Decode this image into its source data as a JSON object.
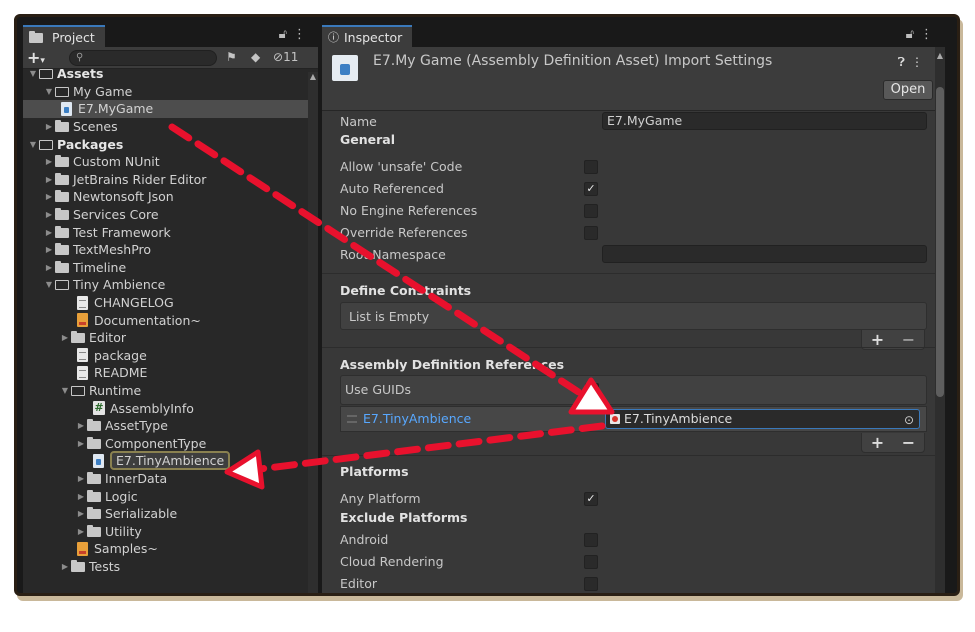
{
  "project": {
    "tab_label": "Project",
    "hidden_count": "11",
    "search_placeholder": "",
    "tree": [
      {
        "label": "Assets",
        "kind": "openfolder",
        "indent": 0,
        "expanded": true,
        "bold": true
      },
      {
        "label": "My Game",
        "kind": "openfolder",
        "indent": 1,
        "expanded": true
      },
      {
        "label": "E7.MyGame",
        "kind": "asm",
        "indent": 2,
        "selected": true
      },
      {
        "label": "Scenes",
        "kind": "folder",
        "indent": 1,
        "collapsed": true
      },
      {
        "label": "Packages",
        "kind": "openfolder",
        "indent": 0,
        "expanded": true,
        "bold": true
      },
      {
        "label": "Custom NUnit",
        "kind": "folder",
        "indent": 1,
        "collapsed": true
      },
      {
        "label": "JetBrains Rider Editor",
        "kind": "folder",
        "indent": 1,
        "collapsed": true
      },
      {
        "label": "Newtonsoft Json",
        "kind": "folder",
        "indent": 1,
        "collapsed": true
      },
      {
        "label": "Services Core",
        "kind": "folder",
        "indent": 1,
        "collapsed": true
      },
      {
        "label": "Test Framework",
        "kind": "folder",
        "indent": 1,
        "collapsed": true
      },
      {
        "label": "TextMeshPro",
        "kind": "folder",
        "indent": 1,
        "collapsed": true
      },
      {
        "label": "Timeline",
        "kind": "folder",
        "indent": 1,
        "collapsed": true
      },
      {
        "label": "Tiny Ambience",
        "kind": "openfolder",
        "indent": 1,
        "expanded": true
      },
      {
        "label": "CHANGELOG",
        "kind": "doc",
        "indent": 3
      },
      {
        "label": "Documentation~",
        "kind": "pdf",
        "indent": 3
      },
      {
        "label": "Editor",
        "kind": "folder",
        "indent": 2,
        "collapsed": true
      },
      {
        "label": "package",
        "kind": "doc",
        "indent": 3
      },
      {
        "label": "README",
        "kind": "doc",
        "indent": 3
      },
      {
        "label": "Runtime",
        "kind": "openfolder",
        "indent": 2,
        "expanded": true
      },
      {
        "label": "AssemblyInfo",
        "kind": "cs",
        "indent": 4
      },
      {
        "label": "AssetType",
        "kind": "folder",
        "indent": 3,
        "collapsed": true
      },
      {
        "label": "ComponentType",
        "kind": "folder",
        "indent": 3,
        "collapsed": true
      },
      {
        "label": "E7.TinyAmbience",
        "kind": "asm",
        "indent": 4,
        "highlighted": true
      },
      {
        "label": "InnerData",
        "kind": "folder",
        "indent": 3,
        "collapsed": true
      },
      {
        "label": "Logic",
        "kind": "folder",
        "indent": 3,
        "collapsed": true
      },
      {
        "label": "Serializable",
        "kind": "folder",
        "indent": 3,
        "collapsed": true
      },
      {
        "label": "Utility",
        "kind": "folder",
        "indent": 3,
        "collapsed": true
      },
      {
        "label": "Samples~",
        "kind": "pdf",
        "indent": 3
      },
      {
        "label": "Tests",
        "kind": "folder",
        "indent": 2,
        "collapsed": true
      }
    ]
  },
  "inspector": {
    "tab_label": "Inspector",
    "title": "E7.My Game (Assembly Definition Asset) Import Settings",
    "open_button": "Open",
    "name_label": "Name",
    "name_value": "E7.MyGame",
    "general_heading": "General",
    "general_options": [
      {
        "label": "Allow 'unsafe' Code",
        "checked": false
      },
      {
        "label": "Auto Referenced",
        "checked": true
      },
      {
        "label": "No Engine References",
        "checked": false
      },
      {
        "label": "Override References",
        "checked": false
      }
    ],
    "root_namespace_label": "Root Namespace",
    "root_namespace_value": "",
    "define_constraints_heading": "Define Constraints",
    "list_empty": "List is Empty",
    "asm_refs_heading": "Assembly Definition References",
    "use_guids_label": "Use GUIDs",
    "use_guids_checked": false,
    "reference_label": "E7.TinyAmbience",
    "reference_value": "E7.TinyAmbience",
    "platforms_heading": "Platforms",
    "any_platform_label": "Any Platform",
    "any_platform_checked": true,
    "exclude_platforms_heading": "Exclude Platforms",
    "exclude_platforms": [
      {
        "label": "Android",
        "checked": false
      },
      {
        "label": "Cloud Rendering",
        "checked": false
      },
      {
        "label": "Editor",
        "checked": false
      }
    ]
  },
  "annotation_color": "#e8112d"
}
